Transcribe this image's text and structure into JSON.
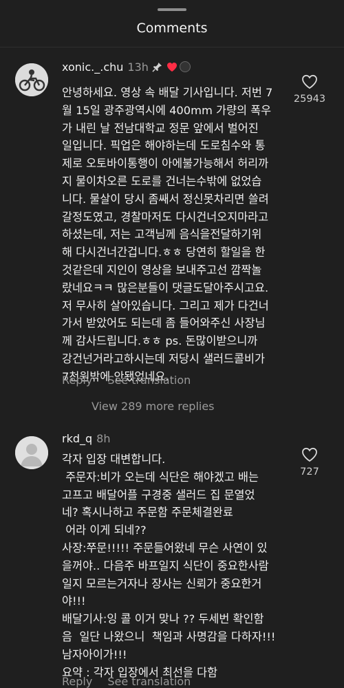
{
  "sheet": {
    "title": "Comments"
  },
  "comments": [
    {
      "username": "xonic._.chu",
      "time": "13h",
      "likes": "25943",
      "text": "안녕하세요. 영상 속 배달 기사입니다. 저번 7\n월 15일 광주광역시에 400mm 가량의 폭우\n가 내린 날 전남대학교 정문 앞에서 벌어진\n일입니다. 픽업은 해야하는데 도로침수와 통\n제로 오토바이통행이 아에불가능해서 허리까\n지 물이차오른 도로를 건너는수밖에 없었습\n니다. 물살이 당시 좀쌔서 정신못차리면 쓸려\n갈정도였고, 경찰마저도 다시건너오지마라고\n하셨는데, 저는 고객님께 음식을전달하기위\n해 다시건너간겁니다.ㅎㅎ 당연히 할일을 한\n것같은데 지인이 영상을 보내주고선 깜짝놀\n랐네요ㅋㅋ 많은분들이 댓글도달아주시고요.\n저 무사히 살아있습니다. 그리고 제가 다건너\n가서 받았어도 되는데 좀 들어와주신 사장님\n께 감사드립니다.ㅎㅎ ps. 돈많이받으니까\n강건넌거라고하시는데 저당시 샐러드콜비가\n7천원밖에 안됐었네요.",
      "reply_label": "Reply",
      "translate_label": "See translation",
      "more_replies": "View 289 more replies"
    },
    {
      "username": "rkd_q",
      "time": "8h",
      "likes": "727",
      "text": "각자 입장 대변합니다.\n 주문자:비가 오는데 식단은 해야겠고 배는\n고프고 배달어플 구경중 샐러드 집 문열었\n네? 혹시나하고 주문함 주문체결완료\n 어라 이게 되네??\n사장:쭈문!!!!! 주문들어왔네 무슨 사연이 있\n을꺼야.. 다음주 바프일지 식단이 중요한사람\n일지 모르는거자나 장사는 신뢰가 중요한거\n야!!!\n배달기사:잉 콜 이거 맞나 ?? 두세번 확인함\n음  일단 나왔으니  책임과 사명감을 다하자!!!\n남자아이가!!!\n요약 : 각자 입장에서 최선을 다함",
      "reply_label": "Reply",
      "translate_label": "See translation"
    }
  ]
}
